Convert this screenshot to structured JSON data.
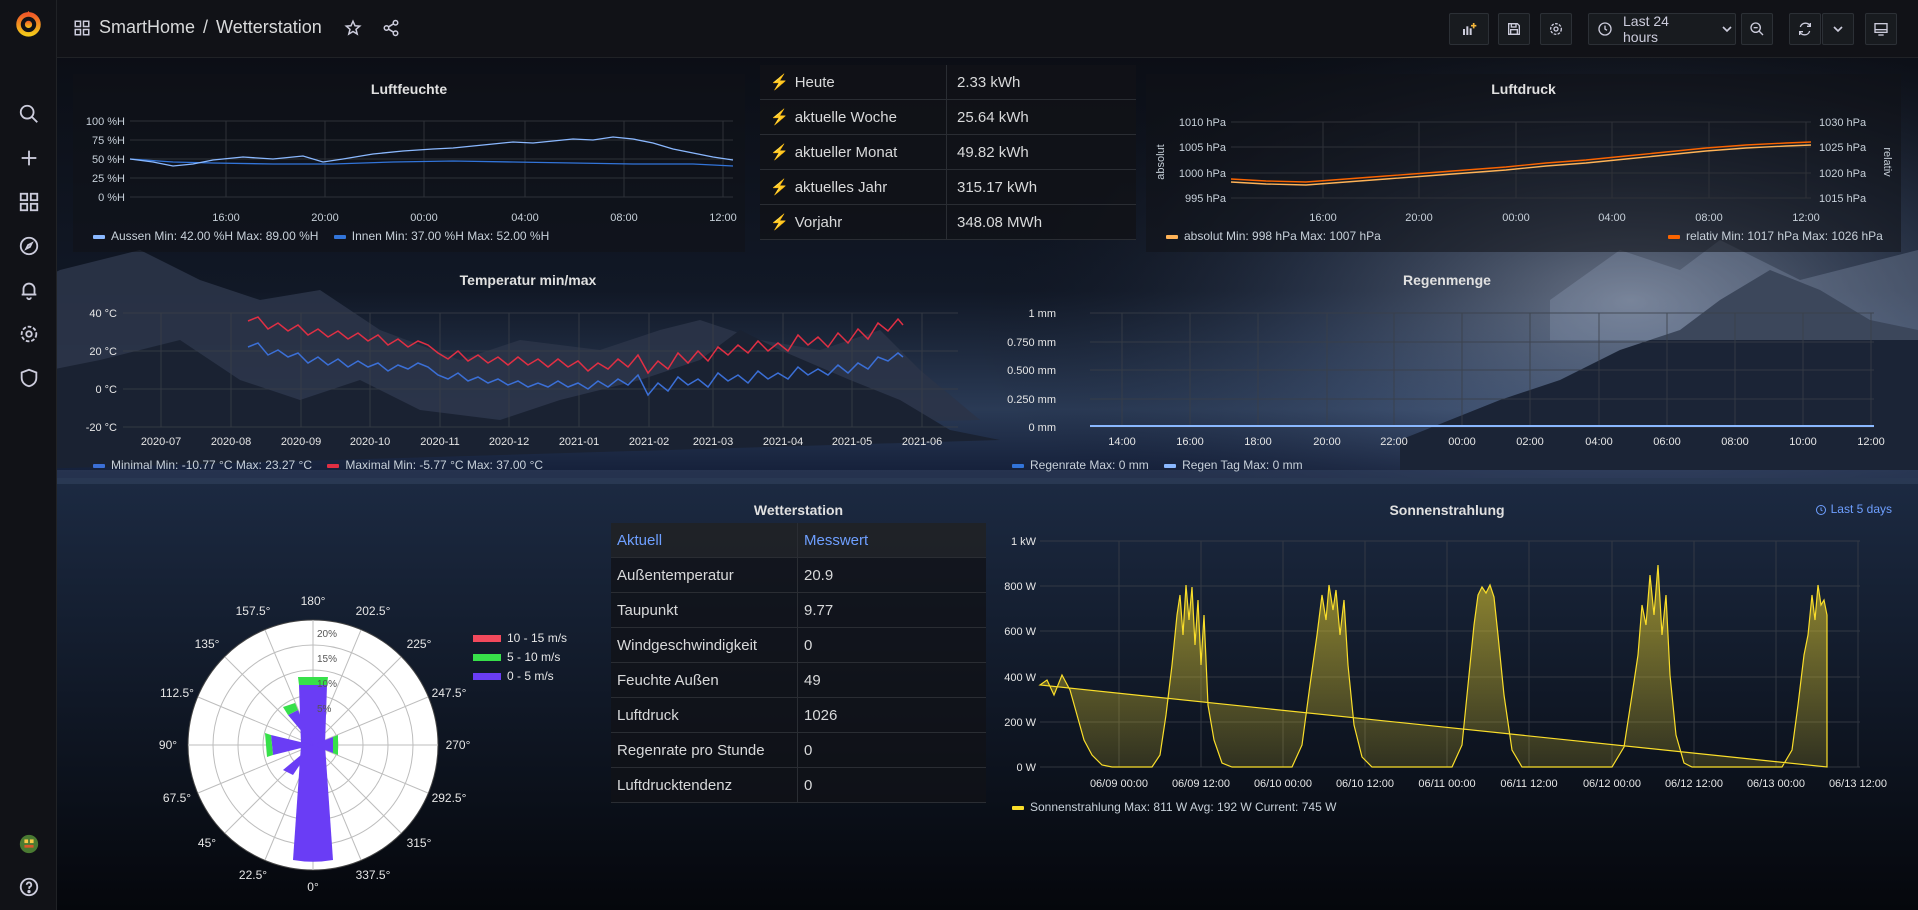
{
  "breadcrumb": {
    "folder": "SmartHome",
    "separator": "/",
    "dashboard": "Wetterstation"
  },
  "toolbar": {
    "time_range": "Last 24 hours"
  },
  "sidebar": {
    "icons": [
      "search-icon",
      "plus-icon",
      "dashboards-icon",
      "explore-icon",
      "alerting-icon",
      "configuration-icon",
      "shield-icon"
    ]
  },
  "colors": {
    "accent_blue": "#5794f2",
    "aussen": "#8ab8ff",
    "innen": "#3274d9",
    "orange": "#ff9830",
    "red": "#e02f44",
    "yellow": "#fade2a",
    "link_blue": "#6e9fff"
  },
  "humidity": {
    "title": "Luftfeuchte",
    "y_ticks": [
      "100 %H",
      "75 %H",
      "50 %H",
      "25 %H",
      "0 %H"
    ],
    "x_ticks": [
      "16:00",
      "20:00",
      "00:00",
      "04:00",
      "08:00",
      "12:00"
    ],
    "legend": [
      {
        "name": "Aussen",
        "stats": "Min: 42.00 %H  Max: 89.00 %H"
      },
      {
        "name": "Innen",
        "stats": "Min: 37.00 %H  Max: 52.00 %H"
      }
    ]
  },
  "energy": {
    "rows": [
      {
        "label": "Heute",
        "value": "2.33 kWh"
      },
      {
        "label": "aktuelle Woche",
        "value": "25.64 kWh"
      },
      {
        "label": "aktueller Monat",
        "value": "49.82 kWh"
      },
      {
        "label": "aktuelles Jahr",
        "value": "315.17 kWh"
      },
      {
        "label": "Vorjahr",
        "value": "348.08 MWh"
      }
    ]
  },
  "pressure": {
    "title": "Luftdruck",
    "y_left_ticks": [
      "1010 hPa",
      "1005 hPa",
      "1000 hPa",
      "995 hPa"
    ],
    "y_right_ticks": [
      "1030 hPa",
      "1025 hPa",
      "1020 hPa",
      "1015 hPa"
    ],
    "y_left_label": "absolut",
    "y_right_label": "relativ",
    "x_ticks": [
      "16:00",
      "20:00",
      "00:00",
      "04:00",
      "08:00",
      "12:00"
    ],
    "legend": [
      {
        "name": "absolut",
        "stats": "Min: 998 hPa  Max: 1007 hPa"
      },
      {
        "name": "relativ",
        "stats": "Min: 1017 hPa  Max: 1026 hPa"
      }
    ]
  },
  "temperature": {
    "title": "Temperatur min/max",
    "y_ticks": [
      "40 °C",
      "20 °C",
      "0 °C",
      "-20 °C"
    ],
    "x_ticks": [
      "2020-07",
      "2020-08",
      "2020-09",
      "2020-10",
      "2020-11",
      "2020-12",
      "2021-01",
      "2021-02",
      "2021-03",
      "2021-04",
      "2021-05",
      "2021-06"
    ],
    "legend": [
      {
        "name": "Minimal",
        "stats": "Min: -10.77 °C  Max: 23.27 °C"
      },
      {
        "name": "Maximal",
        "stats": "Min: -5.77 °C  Max: 37.00 °C"
      }
    ]
  },
  "rain": {
    "title": "Regenmenge",
    "y_ticks": [
      "1 mm",
      "0.750 mm",
      "0.500 mm",
      "0.250 mm",
      "0 mm"
    ],
    "x_ticks": [
      "14:00",
      "16:00",
      "18:00",
      "20:00",
      "22:00",
      "00:00",
      "02:00",
      "04:00",
      "06:00",
      "08:00",
      "10:00",
      "12:00"
    ],
    "legend": [
      {
        "name": "Regenrate",
        "stats": "Max: 0 mm"
      },
      {
        "name": "Regen Tag",
        "stats": "Max: 0 mm"
      }
    ]
  },
  "windrose": {
    "legend": [
      "10 - 15 m/s",
      "5 - 10 m/s",
      "0 - 5 m/s"
    ],
    "direction_labels": [
      "180°",
      "202.5°",
      "225°",
      "247.5°",
      "270°",
      "292.5°",
      "315°",
      "337.5°",
      "0°",
      "22.5°",
      "45°",
      "67.5°",
      "90°",
      "112.5°",
      "135°",
      "157.5°"
    ],
    "ring_labels": [
      "20%",
      "15%",
      "10%",
      "5%"
    ]
  },
  "station": {
    "title": "Wetterstation",
    "headers": [
      "Aktuell",
      "Messwert"
    ],
    "rows": [
      {
        "label": "Außentemperatur",
        "value": "20.9"
      },
      {
        "label": "Taupunkt",
        "value": "9.77"
      },
      {
        "label": "Windgeschwindigkeit",
        "value": "0"
      },
      {
        "label": "Feuchte Außen",
        "value": "49"
      },
      {
        "label": "Luftdruck",
        "value": "1026"
      },
      {
        "label": "Regenrate pro Stunde",
        "value": "0"
      },
      {
        "label": "Luftdrucktendenz",
        "value": "0"
      }
    ]
  },
  "solar": {
    "title": "Sonnenstrahlung",
    "time_override": "Last 5 days",
    "y_ticks": [
      "1 kW",
      "800 W",
      "600 W",
      "400 W",
      "200 W",
      "0 W"
    ],
    "x_ticks": [
      "06/09 00:00",
      "06/09 12:00",
      "06/10 00:00",
      "06/10 12:00",
      "06/11 00:00",
      "06/11 12:00",
      "06/12 00:00",
      "06/12 12:00",
      "06/13 00:00",
      "06/13 12:00"
    ],
    "legend": [
      {
        "name": "Sonnenstrahlung",
        "stats": "Max: 811 W  Avg: 192 W  Current: 745 W"
      }
    ]
  }
}
